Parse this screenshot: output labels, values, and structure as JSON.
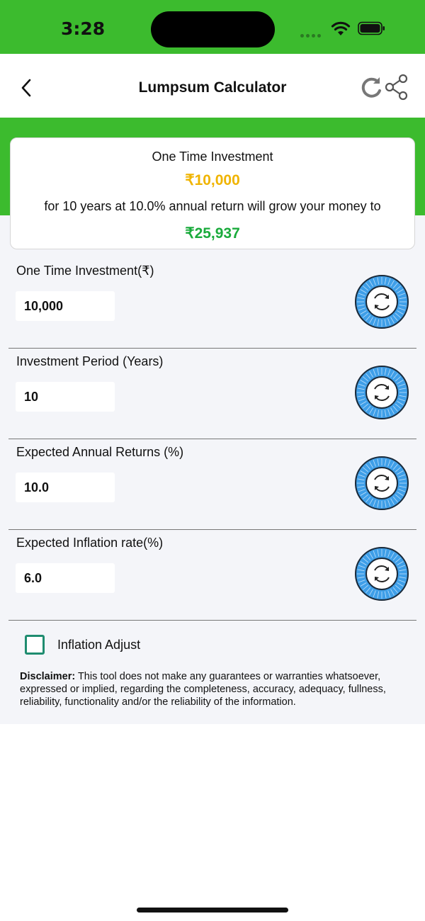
{
  "status_bar": {
    "time": "3:28"
  },
  "nav": {
    "title": "Lumpsum Calculator"
  },
  "summary": {
    "label": "One Time Investment",
    "amount": "₹10,000",
    "description": "for 10 years at 10.0% annual return will grow your money to",
    "result": "₹25,937"
  },
  "rows": [
    {
      "label": "One Time Investment(₹)",
      "value": "10,000"
    },
    {
      "label": "Investment Period (Years)",
      "value": "10"
    },
    {
      "label": "Expected Annual Returns (%)",
      "value": "10.0"
    },
    {
      "label": "Expected Inflation rate(%)",
      "value": "6.0"
    }
  ],
  "inflation_adjust": {
    "label": "Inflation Adjust",
    "checked": false
  },
  "disclaimer": {
    "title": "Disclaimer:",
    "text": " This tool does not make any guarantees or warranties whatsoever, expressed or implied, regarding the completeness, accuracy, adequacy, fullness, reliability, functionality and/or the reliability of the information."
  },
  "colors": {
    "brand_green": "#3cbb2e",
    "amount_yellow": "#f0b400",
    "result_green": "#1aab3c",
    "dial_blue": "#3f9fe8",
    "checkbox_teal": "#1f8c70"
  },
  "icons": {
    "back": "chevron-left-icon",
    "reset_all": "refresh-icon",
    "share": "share-icon",
    "dial": "dial-reset-icon"
  }
}
